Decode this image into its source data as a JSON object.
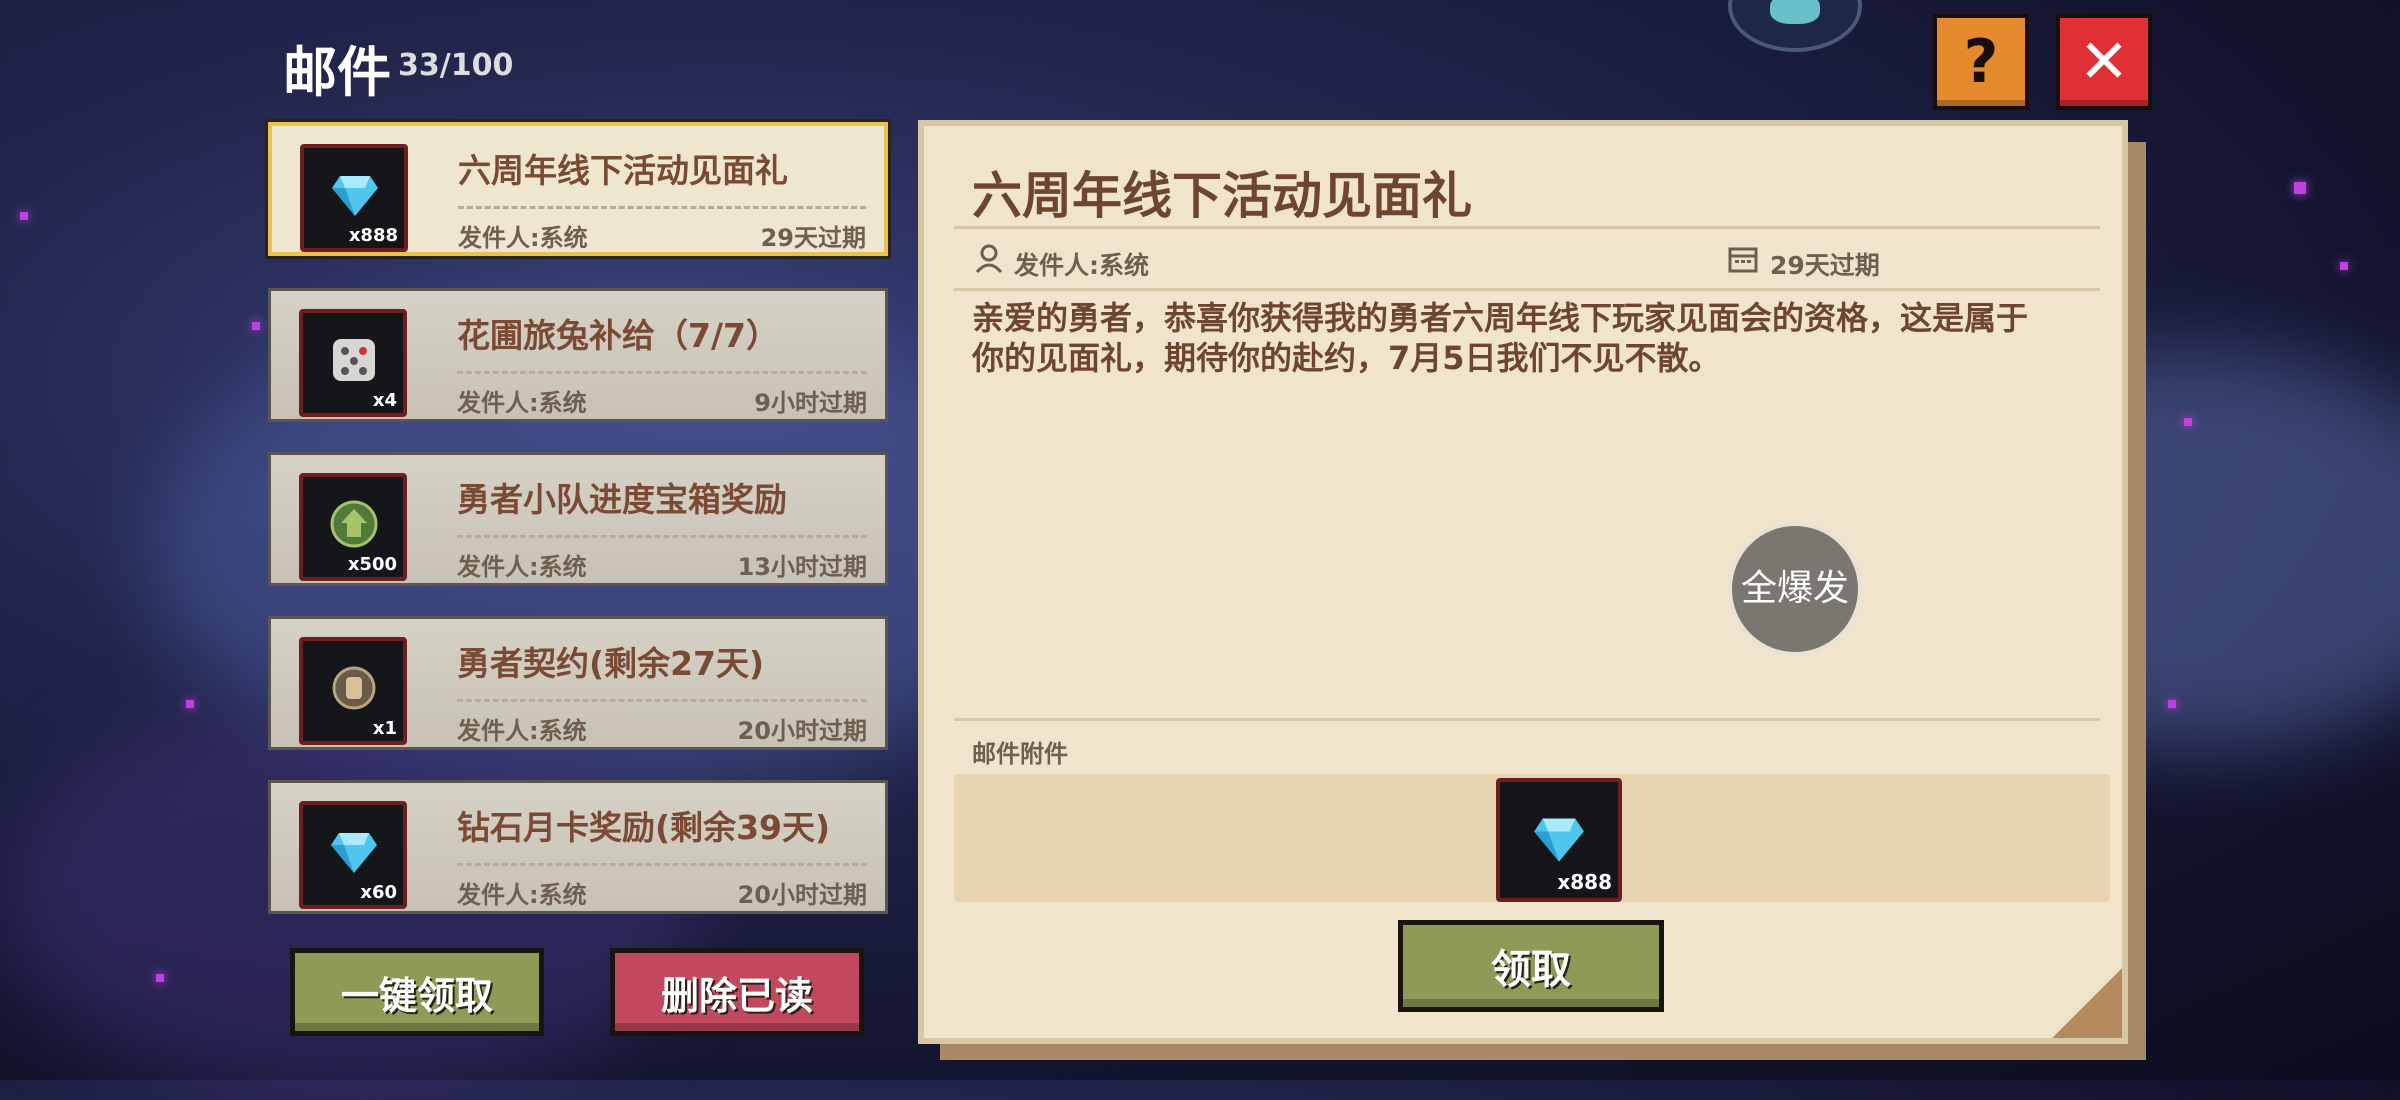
{
  "header": {
    "title": "邮件",
    "count": "33/100"
  },
  "mails": [
    {
      "title": "六周年线下活动见面礼",
      "sender": "发件人:系统",
      "expire": "29天过期",
      "qty": "x888",
      "icon": "diamond-icon",
      "selected": true
    },
    {
      "title": "花圃旅兔补给（7/7）",
      "sender": "发件人:系统",
      "expire": "9小时过期",
      "qty": "x4",
      "icon": "dice-icon",
      "selected": false
    },
    {
      "title": "勇者小队进度宝箱奖励",
      "sender": "发件人:系统",
      "expire": "13小时过期",
      "qty": "x500",
      "icon": "emblem-icon",
      "selected": false
    },
    {
      "title": "勇者契约(剩余27天)",
      "sender": "发件人:系统",
      "expire": "20小时过期",
      "qty": "x1",
      "icon": "medal-icon",
      "selected": false
    },
    {
      "title": "钻石月卡奖励(剩余39天)",
      "sender": "发件人:系统",
      "expire": "20小时过期",
      "qty": "x60",
      "icon": "diamond-icon",
      "selected": false
    }
  ],
  "buttons": {
    "claim_all": "一键领取",
    "delete_read": "删除已读",
    "claim": "领取",
    "help": "?",
    "close": "✕"
  },
  "detail": {
    "title": "六周年线下活动见面礼",
    "sender": "发件人:系统",
    "expire": "29天过期",
    "body": "亲爱的勇者，恭喜你获得我的勇者六周年线下玩家见面会的资格，这是属于你的见面礼，期待你的赴约，7月5日我们不见不散。",
    "attachments_label": "邮件附件",
    "attachment_qty": "x888",
    "burst_badge": "全爆发"
  },
  "colors": {
    "claim_green": "#8e9a56",
    "delete_red": "#c2485e",
    "help_orange": "#e58a2c",
    "close_red": "#de3035",
    "paper": "#f0e5cc"
  }
}
